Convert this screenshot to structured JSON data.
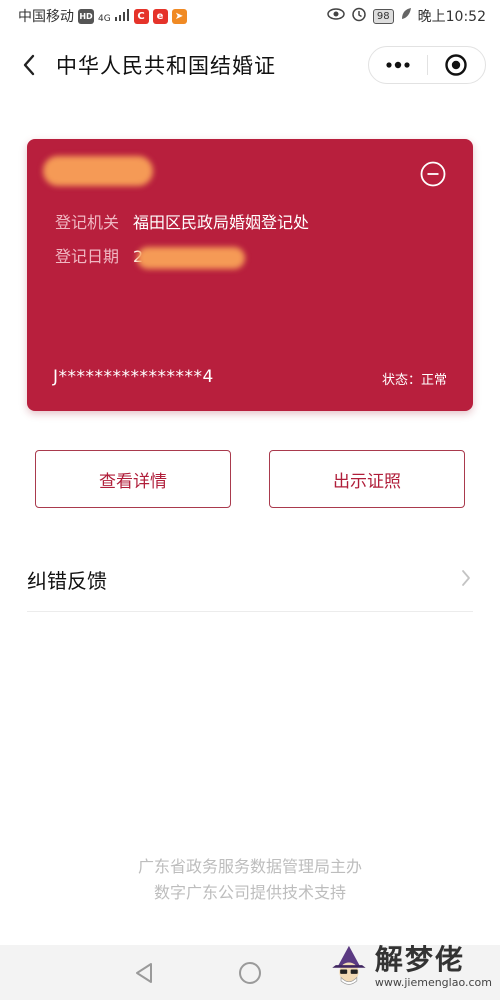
{
  "status_bar": {
    "carrier": "中国移动",
    "network_badge": "HD",
    "signal": "4G",
    "battery": "98",
    "time": "晚上10:52",
    "icons": [
      "hd-icon",
      "signal-icon",
      "app-c-icon",
      "app-e-icon",
      "app-paper-plane-icon",
      "eye-icon",
      "alarm-icon",
      "battery-icon",
      "leaf-icon"
    ]
  },
  "titlebar": {
    "title": "中华人民共和国结婚证",
    "menu_icon": "more-dots-icon",
    "close_icon": "target-close-icon"
  },
  "card": {
    "name_masked": "",
    "office_label": "登记机关",
    "office_value": "福田区民政局婚姻登记处",
    "date_label": "登记日期",
    "date_prefix": "2",
    "cert_number": "J****************4",
    "status": "状态：正常",
    "colors": {
      "background": "#b81f3d",
      "redaction": "#f59a56"
    }
  },
  "buttons": {
    "detail": "查看详情",
    "show": "出示证照"
  },
  "feedback": {
    "label": "纠错反馈"
  },
  "footer": {
    "line1": "广东省政务服务数据管理局主办",
    "line2": "数字广东公司提供技术支持"
  },
  "watermark": {
    "name": "解梦佬",
    "url": "www.jiemenglao.com"
  }
}
